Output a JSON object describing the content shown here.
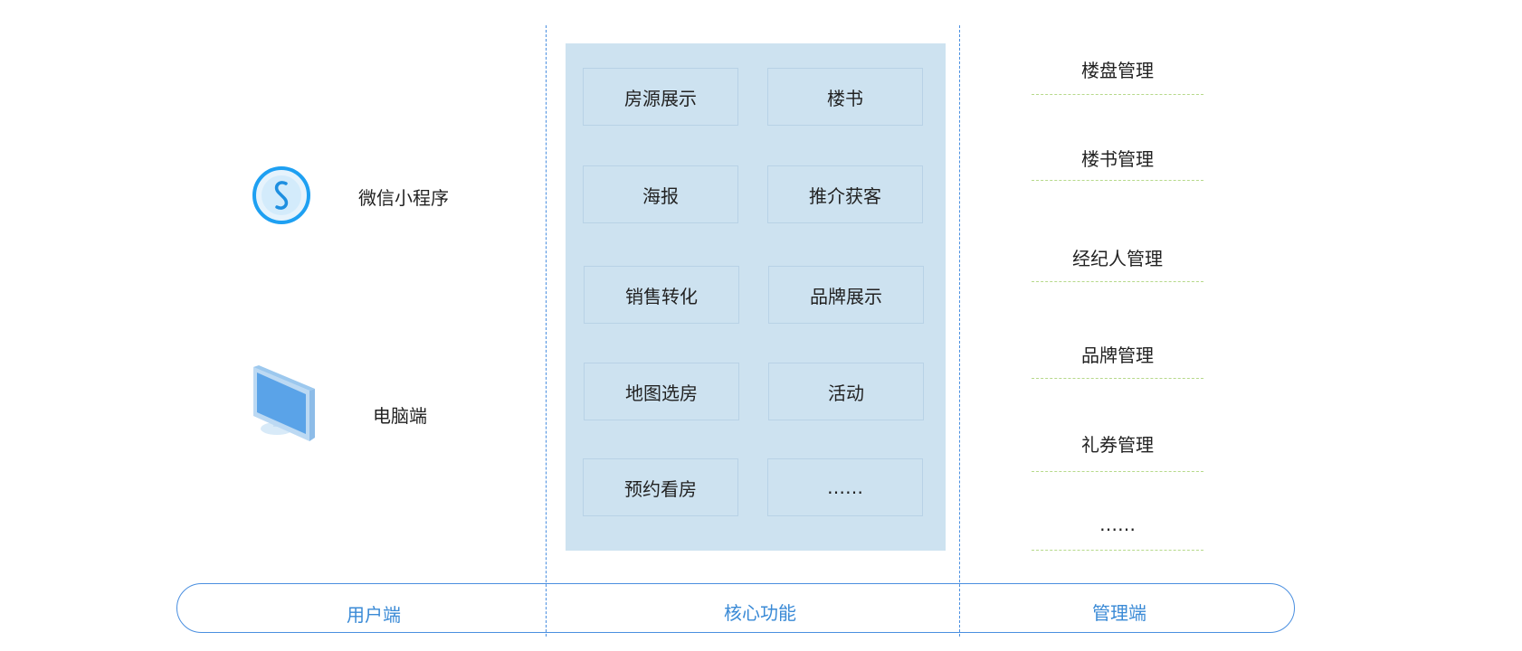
{
  "user_side": {
    "items": [
      {
        "label": "微信小程序",
        "icon": "wechat-miniprogram-icon"
      },
      {
        "label": "电脑端",
        "icon": "computer-monitor-icon"
      }
    ]
  },
  "core": {
    "cells": [
      "房源展示",
      "楼书",
      "海报",
      "推介获客",
      "销售转化",
      "品牌展示",
      "地图选房",
      "活动",
      "预约看房",
      "……"
    ]
  },
  "management": {
    "items": [
      "楼盘管理",
      "楼书管理",
      "经纪人管理",
      "品牌管理",
      "礼券管理",
      "……"
    ]
  },
  "footer": {
    "labels": [
      "用户端",
      "核心功能",
      "管理端"
    ]
  },
  "colors": {
    "accent_blue": "#3a8ad6",
    "divider_blue": "#4a8fe0",
    "core_bg": "#cde2f0",
    "mgmt_divider_green": "#b6d98a"
  }
}
